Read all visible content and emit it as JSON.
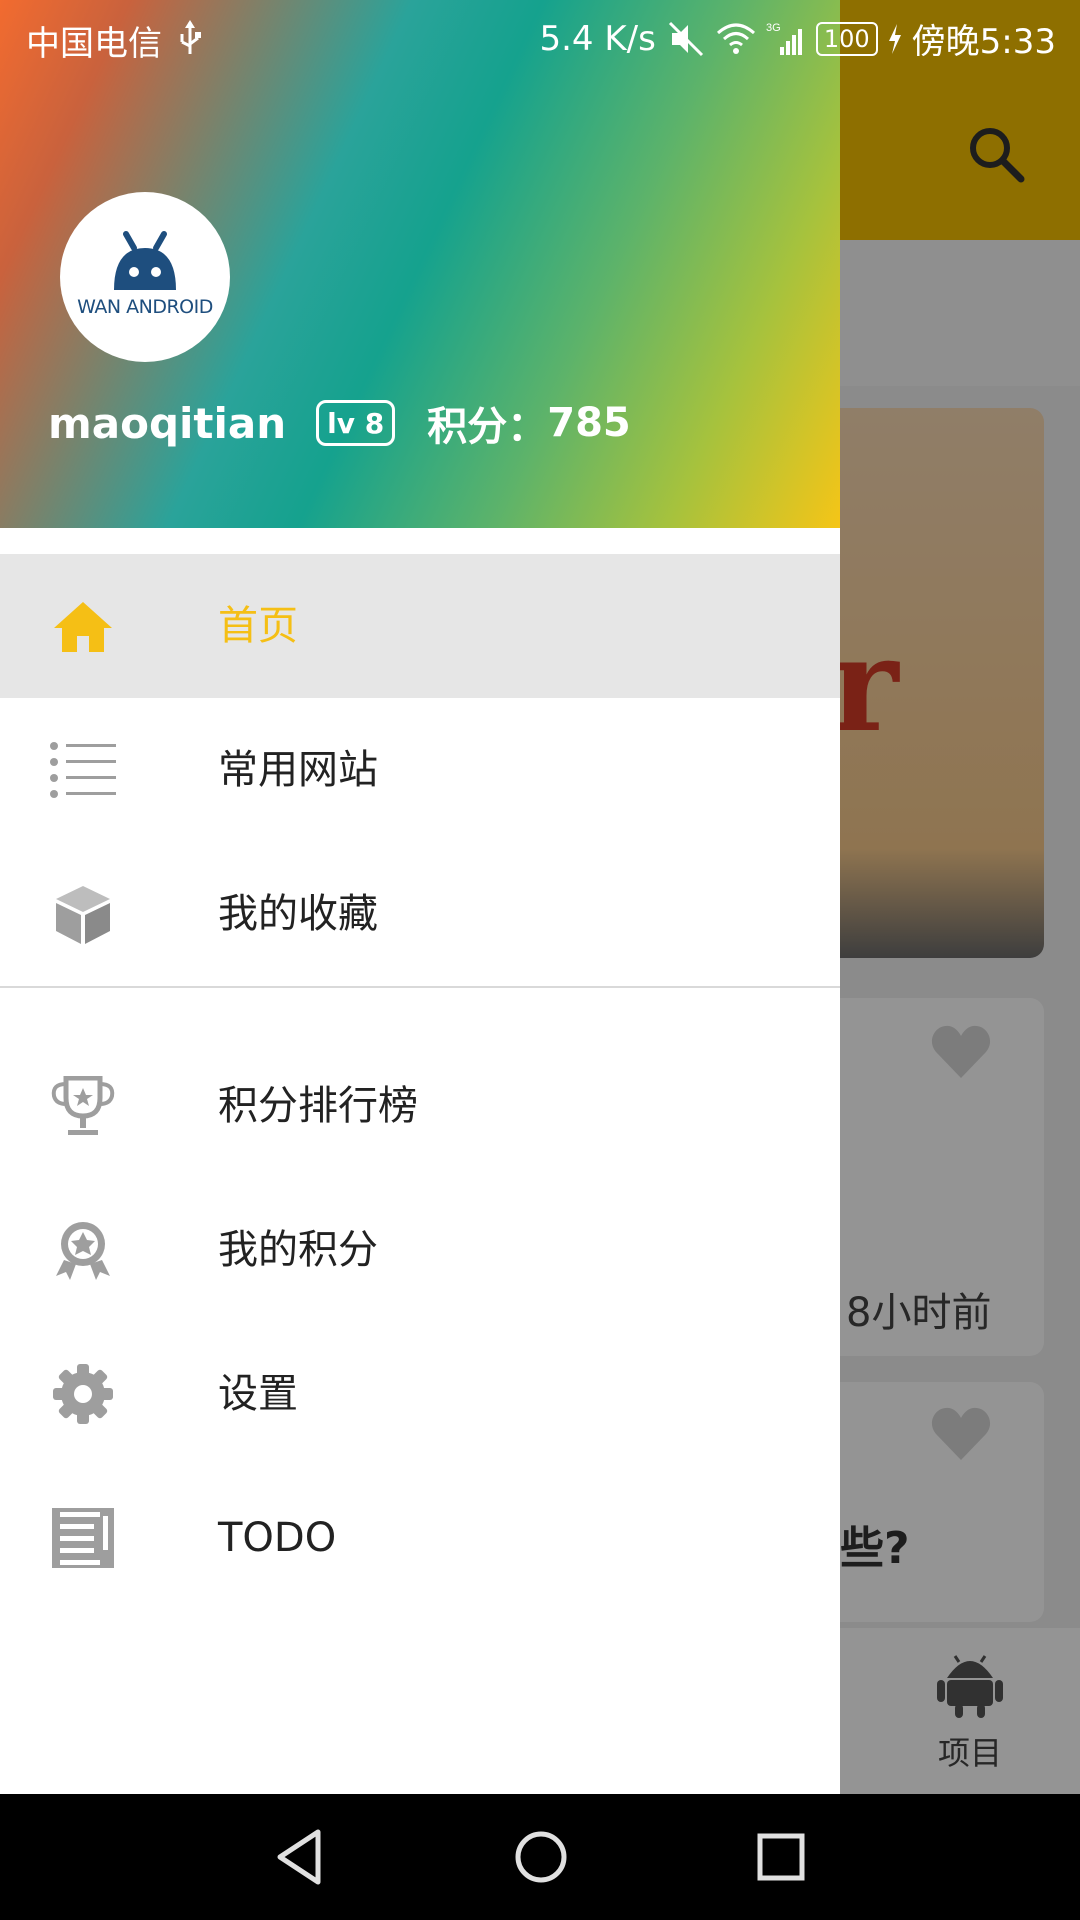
{
  "status_bar": {
    "carrier": "中国电信",
    "usb_icon": "usb-icon",
    "network_speed": "5.4 K/s",
    "network_type": "3G",
    "battery": "100",
    "time": "傍晚5:33"
  },
  "background_app": {
    "search_icon": "search-icon",
    "banner_letter": "r",
    "card1_time": "8小时前",
    "card2_title_fragment": "些?",
    "bottom_nav_label": "项目"
  },
  "drawer": {
    "header": {
      "avatar_text": "WAN ANDROID",
      "username": "maoqitian",
      "level": "lv 8",
      "points_label": "积分：",
      "points_value": "785"
    },
    "menu_group_1": [
      {
        "label": "首页",
        "icon": "home-icon",
        "active": true
      },
      {
        "label": "常用网站",
        "icon": "list-icon",
        "active": false
      },
      {
        "label": "我的收藏",
        "icon": "cube-icon",
        "active": false
      }
    ],
    "menu_group_2": [
      {
        "label": "积分排行榜",
        "icon": "trophy-icon"
      },
      {
        "label": "我的积分",
        "icon": "medal-icon"
      },
      {
        "label": "设置",
        "icon": "gear-icon"
      },
      {
        "label": "TODO",
        "icon": "todo-icon"
      }
    ]
  },
  "colors": {
    "accent": "#f5bf15",
    "toolbar": "#f4bf00",
    "icon_gray": "#9e9e9e"
  },
  "nav_bar": {
    "back": "back-icon",
    "home": "home-circle-icon",
    "recent": "recent-apps-icon"
  }
}
